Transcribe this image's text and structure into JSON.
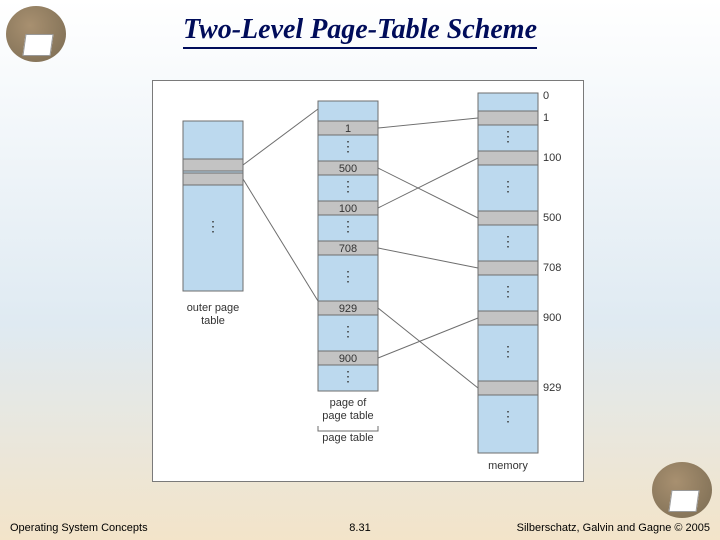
{
  "title": "Two-Level Page-Table Scheme",
  "footer": {
    "left": "Operating System Concepts",
    "mid": "8.31",
    "right": "Silberschatz, Galvin and Gagne © 2005"
  },
  "labels": {
    "outer": "outer page\ntable",
    "inner": "page of\npage table",
    "pagetable": "page table",
    "memory": "memory"
  },
  "inner_values": [
    "1",
    "500",
    "100",
    "708",
    "929",
    "900"
  ],
  "memory_values": [
    "0",
    "1",
    "100",
    "500",
    "708",
    "900",
    "929"
  ]
}
